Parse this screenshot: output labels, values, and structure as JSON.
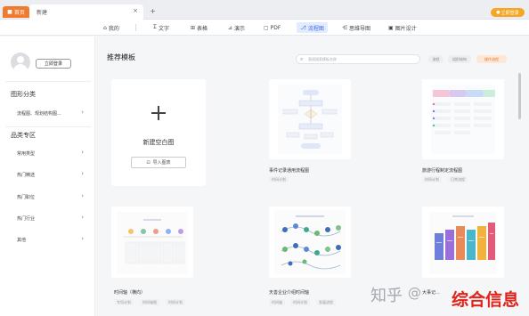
{
  "titlebar": {
    "home_tab": "首页",
    "doc_tab": "新建",
    "close_glyph": "×",
    "add_glyph": "+",
    "login_button": "立即登录"
  },
  "toolbar": {
    "items": [
      {
        "label": "我的",
        "icon": "home-icon",
        "glyph": "⌂"
      },
      {
        "label": "文字",
        "icon": "text-icon",
        "glyph": "Ꮖ"
      },
      {
        "label": "表格",
        "icon": "table-icon",
        "glyph": "⊞"
      },
      {
        "label": "演示",
        "icon": "presentation-icon",
        "glyph": "⊿"
      },
      {
        "label": "PDF",
        "icon": "pdf-icon",
        "glyph": "▢"
      },
      {
        "label": "流程图",
        "icon": "flowchart-icon",
        "glyph": "⎇"
      },
      {
        "label": "思维导图",
        "icon": "mindmap-icon",
        "glyph": "⋲"
      },
      {
        "label": "图片设计",
        "icon": "image-design-icon",
        "glyph": "▣"
      }
    ],
    "active_index": 5
  },
  "sidebar": {
    "login_button": "立即登录",
    "section_graph": "图形分类",
    "graph_items": [
      {
        "label": "流程图、规划结构图..."
      }
    ],
    "section_category": "品类专区",
    "category_items": [
      {
        "label": "常用类型"
      },
      {
        "label": "热门精选"
      },
      {
        "label": "热门职位"
      },
      {
        "label": "热门行业"
      },
      {
        "label": "其他"
      }
    ],
    "chevron": "›"
  },
  "main": {
    "title": "推荐模板",
    "search_placeholder": "直接搜索模板名称",
    "search_icon": "⌕",
    "chips": [
      "流程",
      "组织结构",
      "操作流程 "
    ],
    "new_card": {
      "label": "新建空白图",
      "import_label": "导入图表",
      "import_icon": "⊡"
    },
    "templates": [
      {
        "name": "事件记录通用流程图",
        "tags": [
          "时间计划"
        ]
      },
      {
        "name": "旅游行程制定流程图",
        "tags": [
          "时间计划",
          "日常流程"
        ]
      },
      {
        "name": "时间轴（横向）",
        "tags": [
          "专项计划",
          "时间轴图",
          "时间计划"
        ]
      },
      {
        "name": "天善企业介绍时间轴",
        "tags": [
          "时间轴",
          "时间计划",
          "发展进程"
        ]
      },
      {
        "name": "大事记...",
        "tags": []
      }
    ]
  },
  "watermark": {
    "zhihu": "知乎",
    "at": "@",
    "brand": "综合信息"
  },
  "colors": {
    "accent_orange": "#f07a2d",
    "accent_blue": "#3a6de0",
    "brand_red": "#e2231a",
    "login_yellow": "#f5a623"
  }
}
